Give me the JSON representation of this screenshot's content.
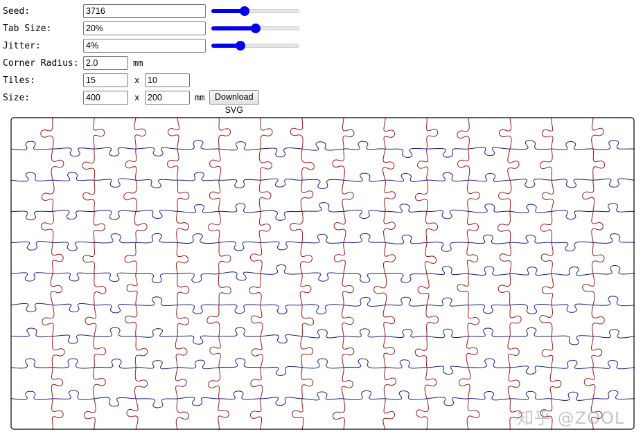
{
  "controls": {
    "seed": {
      "label": "Seed:",
      "value": "3716",
      "slider_fraction": 0.38
    },
    "tab_size": {
      "label": "Tab Size:",
      "value": "20%",
      "slider_fraction": 0.5
    },
    "jitter": {
      "label": "Jitter:",
      "value": "4%",
      "slider_fraction": 0.33
    },
    "corner_radius": {
      "label": "Corner Radius:",
      "value": "2.0",
      "unit": "mm"
    },
    "tiles": {
      "label": "Tiles:",
      "x_value": "15",
      "separator": "x",
      "y_value": "10"
    },
    "size": {
      "label": "Size:",
      "w_value": "400",
      "separator": "x",
      "h_value": "200",
      "unit": "mm"
    },
    "download_label": "Download SVG"
  },
  "puzzle": {
    "columns": 15,
    "rows": 10,
    "seed": 3716,
    "tab_size": 0.2,
    "jitter": 0.04,
    "horizontal_cut_color": "#1c1c7a",
    "vertical_cut_color": "#8b1a1a",
    "border_color": "#000000"
  },
  "watermark": "知乎 @ZOOL"
}
